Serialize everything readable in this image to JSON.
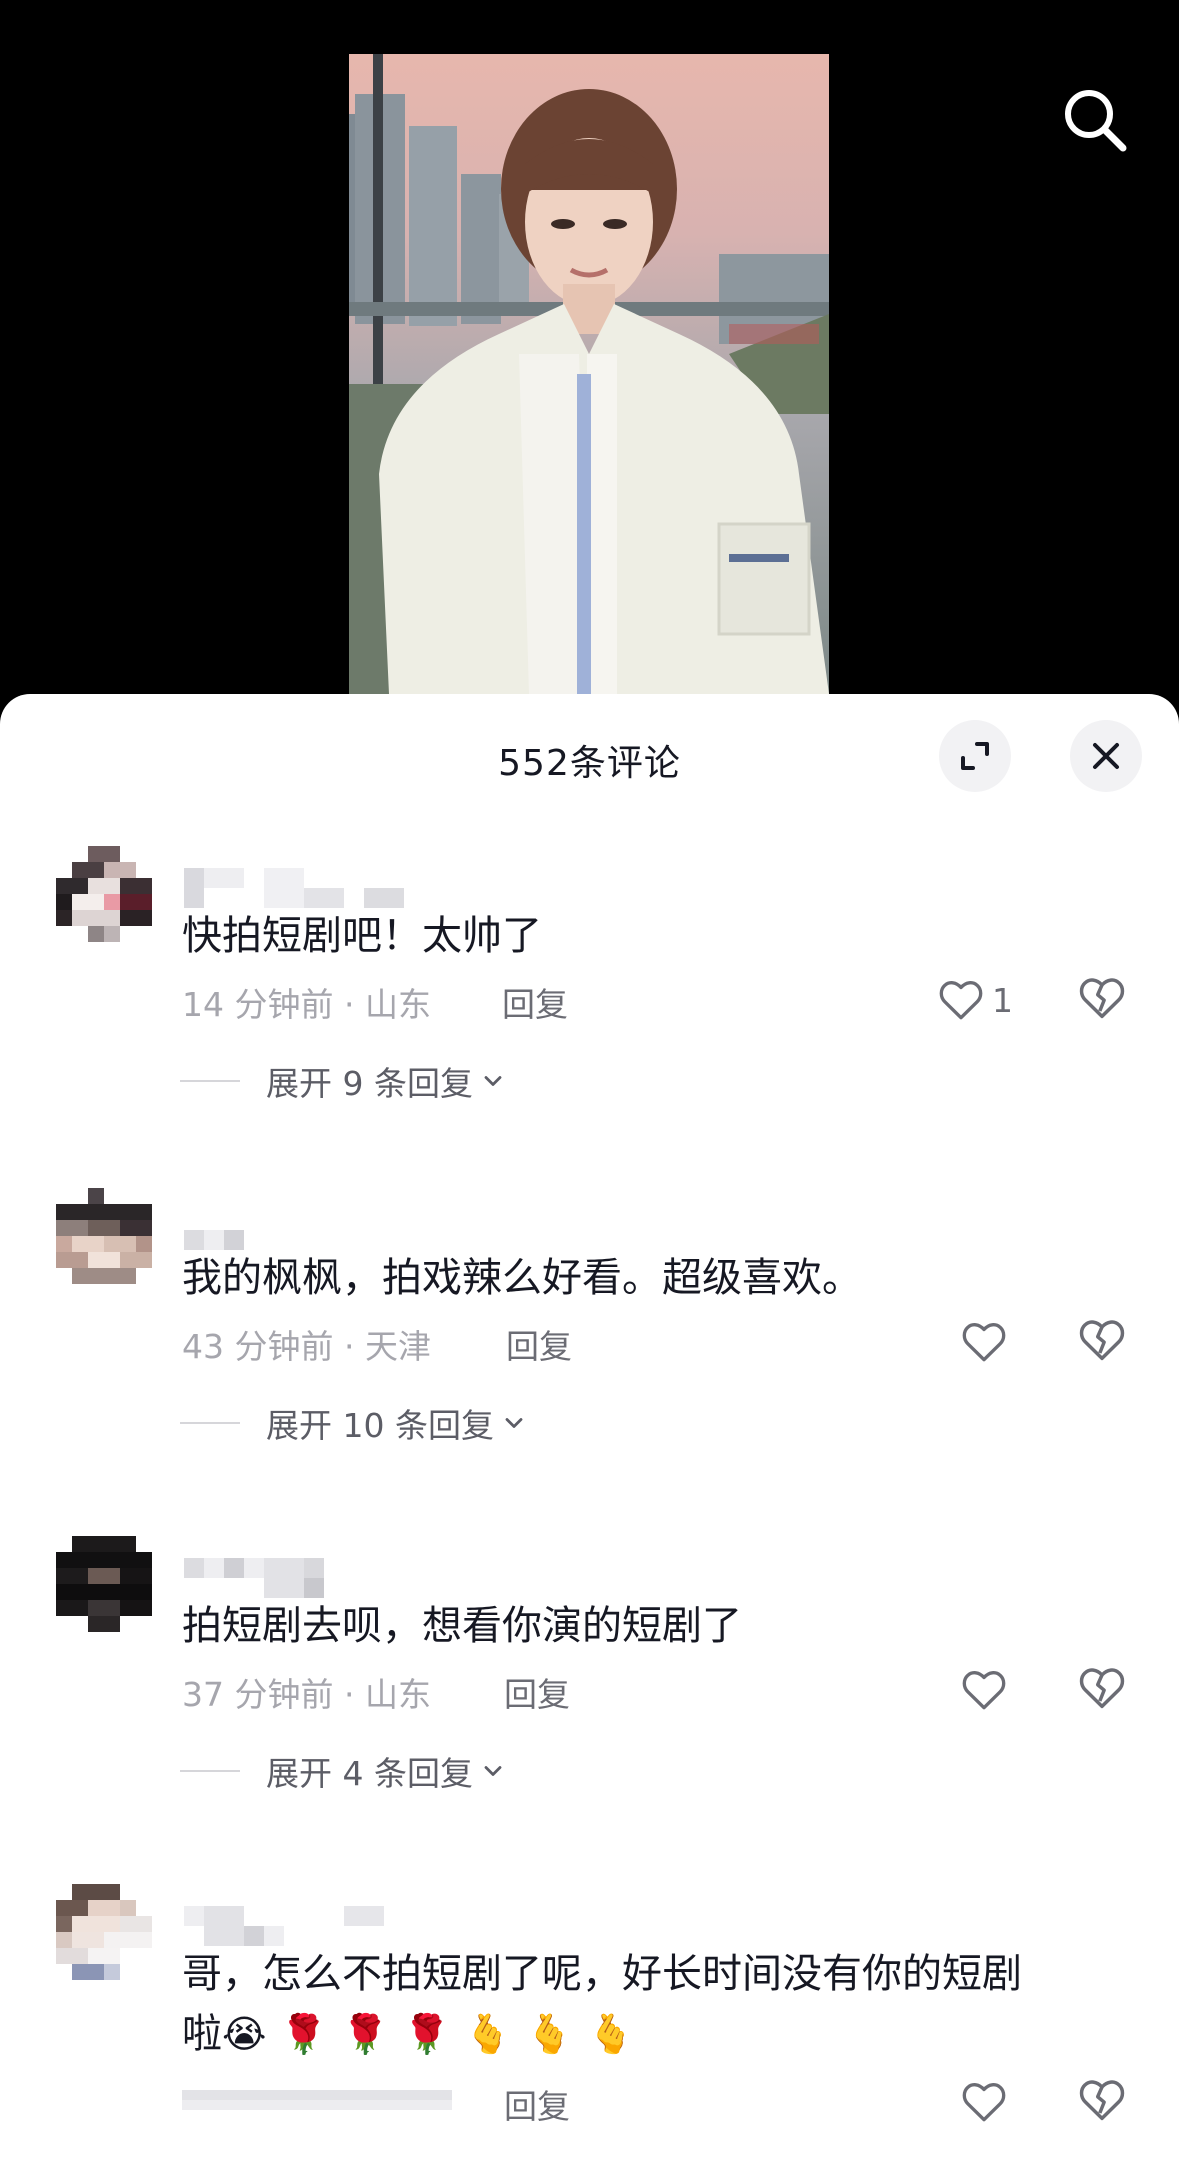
{
  "video": {
    "colors": {
      "background": "#000000"
    }
  },
  "toolbar": {
    "search_icon": "search-icon"
  },
  "sheet": {
    "title": "552条评论",
    "expand_icon": "expand-icon",
    "close_icon": "close-icon"
  },
  "comments": [
    {
      "text": "快拍短剧吧！太帅了",
      "time_location": "14 分钟前 · 山东",
      "reply_label": "回复",
      "like_count": "1",
      "expand_label": "展开 9 条回复"
    },
    {
      "text": "我的枫枫，拍戏辣么好看。超级喜欢。",
      "time_location": "43 分钟前 · 天津",
      "reply_label": "回复",
      "like_count": "",
      "expand_label": "展开 10 条回复"
    },
    {
      "text": "拍短剧去呗，想看你演的短剧了",
      "time_location": "37 分钟前 · 山东",
      "reply_label": "回复",
      "like_count": "",
      "expand_label": "展开 4 条回复"
    },
    {
      "text_line1": "哥，怎么不拍短剧了呢，好长时间没有你的短剧",
      "text_line2": "啦",
      "emojis": [
        "😭",
        "🌹",
        "🌹",
        "🌹",
        "🫰",
        "🫰",
        "🫰"
      ],
      "reply_label": "回复",
      "like_count": ""
    }
  ]
}
